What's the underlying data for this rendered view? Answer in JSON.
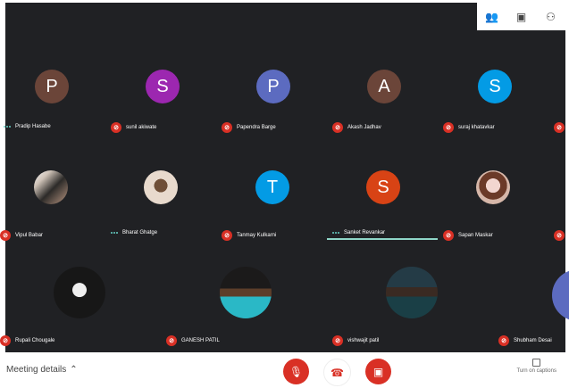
{
  "top_actions": {
    "people_icon": "people-icon",
    "chat_icon": "chat-icon",
    "activities_icon": "activities-icon"
  },
  "participants": [
    {
      "name": "Pradip Hasabe",
      "initial": "P",
      "color": "#6b4539",
      "status": "speaking"
    },
    {
      "name": "sunil akiwate",
      "initial": "S",
      "color": "#9c27b0",
      "status": "muted"
    },
    {
      "name": "Papendra Barge",
      "initial": "P",
      "color": "#5c6bc0",
      "status": "muted"
    },
    {
      "name": "Akash Jadhav",
      "initial": "A",
      "color": "#6b4539",
      "status": "muted"
    },
    {
      "name": "suraj khatavkar",
      "initial": "S",
      "color": "#039be5",
      "status": "muted"
    },
    {
      "name": "Vipul Babar",
      "initial": "",
      "color": "#d8c0b0",
      "status": "muted"
    },
    {
      "name": "Bharat Ghatge",
      "initial": "",
      "color": "#e5d5c8",
      "status": "speaking"
    },
    {
      "name": "Tanmay Kulkarni",
      "initial": "T",
      "color": "#039be5",
      "status": "muted"
    },
    {
      "name": "Sanket Revankar",
      "initial": "S",
      "color": "#d84315",
      "status": "speaking"
    },
    {
      "name": "Sapan Maskar",
      "initial": "",
      "color": "#d6b7a9",
      "status": "muted"
    },
    {
      "name": "Rupali Chougale",
      "initial": "",
      "color": "#171717",
      "status": "muted"
    },
    {
      "name": "GANESH PATIL",
      "initial": "",
      "color": "#1b3d46",
      "status": "muted"
    },
    {
      "name": "vishwajit patil",
      "initial": "",
      "color": "#123d44",
      "status": "muted"
    },
    {
      "name": "Shubham Desai",
      "initial": "",
      "color": "#5c6bc0",
      "status": "muted"
    }
  ],
  "bottom": {
    "meeting_details": "Meeting details",
    "captions": "Turn on captions"
  }
}
